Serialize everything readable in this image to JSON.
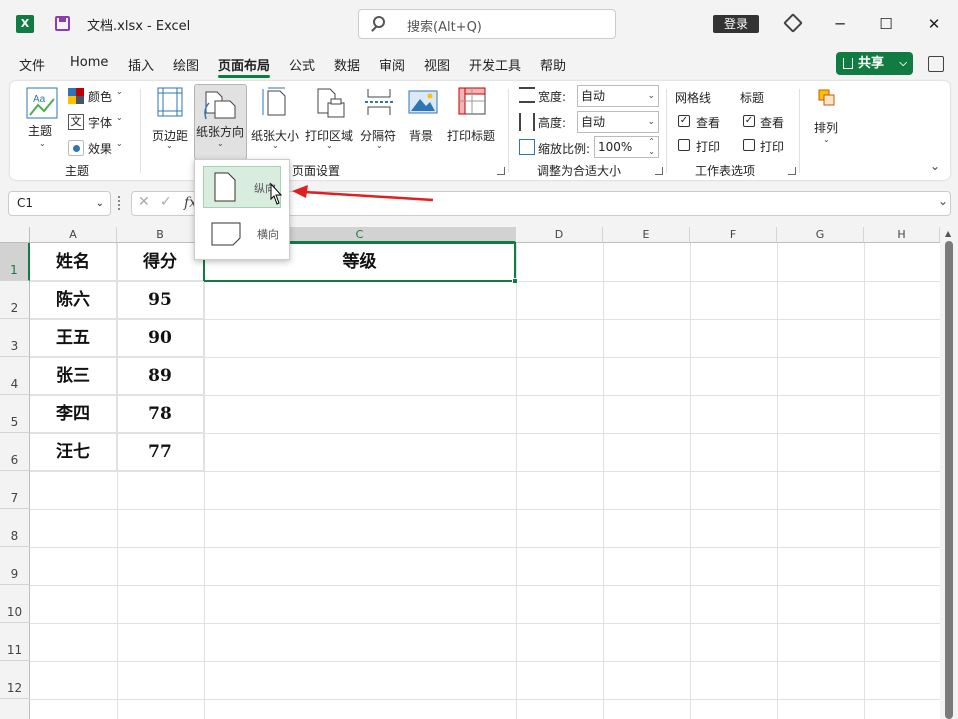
{
  "titlebar": {
    "app_letter": "X",
    "title": "文档.xlsx  -  Excel",
    "search_placeholder": "搜索(Alt+Q)",
    "login": "登录",
    "minimize": "─",
    "maximize": "☐",
    "close": "✕"
  },
  "tabs": [
    "文件",
    "Home",
    "插入",
    "绘图",
    "页面布局",
    "公式",
    "数据",
    "审阅",
    "视图",
    "开发工具",
    "帮助"
  ],
  "share_label": "共享",
  "ribbon": {
    "theme": {
      "themes": "主题",
      "colors": "颜色",
      "fonts": "字体",
      "effects": "效果",
      "group": "主题"
    },
    "page_setup": {
      "margins": "页边距",
      "orientation": "纸张方向",
      "size": "纸张大小",
      "print_area": "打印区域",
      "breaks": "分隔符",
      "background": "背景",
      "print_titles": "打印标题",
      "group": "页面设置"
    },
    "scale": {
      "width_label": "宽度:",
      "width_value": "自动",
      "height_label": "高度:",
      "height_value": "自动",
      "scale_label": "缩放比例:",
      "scale_value": "100%",
      "group": "调整为合适大小"
    },
    "sheet_options": {
      "gridlines": "网格线",
      "headings": "标题",
      "view": "查看",
      "print": "打印",
      "group": "工作表选项"
    },
    "arrange": {
      "label": "排列"
    }
  },
  "orientation_menu": {
    "portrait": "纵向",
    "landscape": "横向"
  },
  "formula_bar": {
    "name_box": "C1",
    "fx": "fx"
  },
  "columns": [
    "A",
    "B",
    "C",
    "D",
    "E",
    "F",
    "G",
    "H"
  ],
  "rows": [
    "1",
    "2",
    "3",
    "4",
    "5",
    "6",
    "7",
    "8",
    "9",
    "10",
    "11",
    "12"
  ],
  "table": {
    "header": [
      "姓名",
      "得分",
      "等级"
    ],
    "data": [
      [
        "陈六",
        "95"
      ],
      [
        "王五",
        "90"
      ],
      [
        "张三",
        "89"
      ],
      [
        "李四",
        "78"
      ],
      [
        "汪七",
        "77"
      ]
    ]
  },
  "colors": {
    "accent": "#107c41",
    "arrow": "#e02020"
  }
}
